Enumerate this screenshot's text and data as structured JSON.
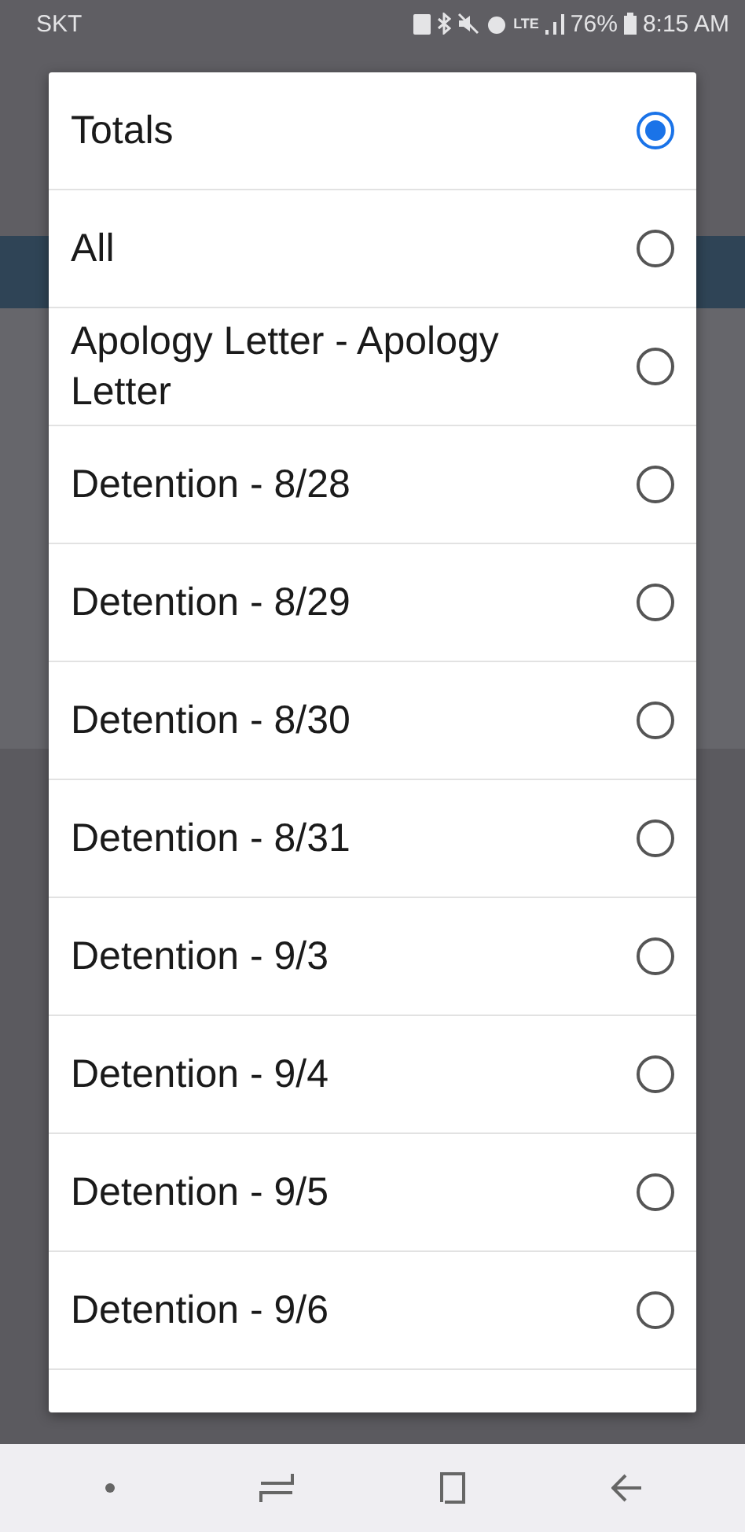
{
  "status_bar": {
    "carrier": "SKT",
    "network": "LTE",
    "battery": "76%",
    "time": "8:15 AM"
  },
  "options": [
    {
      "label": "Totals",
      "selected": true
    },
    {
      "label": "All",
      "selected": false
    },
    {
      "label": "Apology Letter - Apology Letter",
      "selected": false
    },
    {
      "label": "Detention - 8/28",
      "selected": false
    },
    {
      "label": "Detention - 8/29",
      "selected": false
    },
    {
      "label": "Detention - 8/30",
      "selected": false
    },
    {
      "label": "Detention - 8/31",
      "selected": false
    },
    {
      "label": "Detention - 9/3",
      "selected": false
    },
    {
      "label": "Detention - 9/4",
      "selected": false
    },
    {
      "label": "Detention - 9/5",
      "selected": false
    },
    {
      "label": "Detention - 9/6",
      "selected": false
    }
  ]
}
